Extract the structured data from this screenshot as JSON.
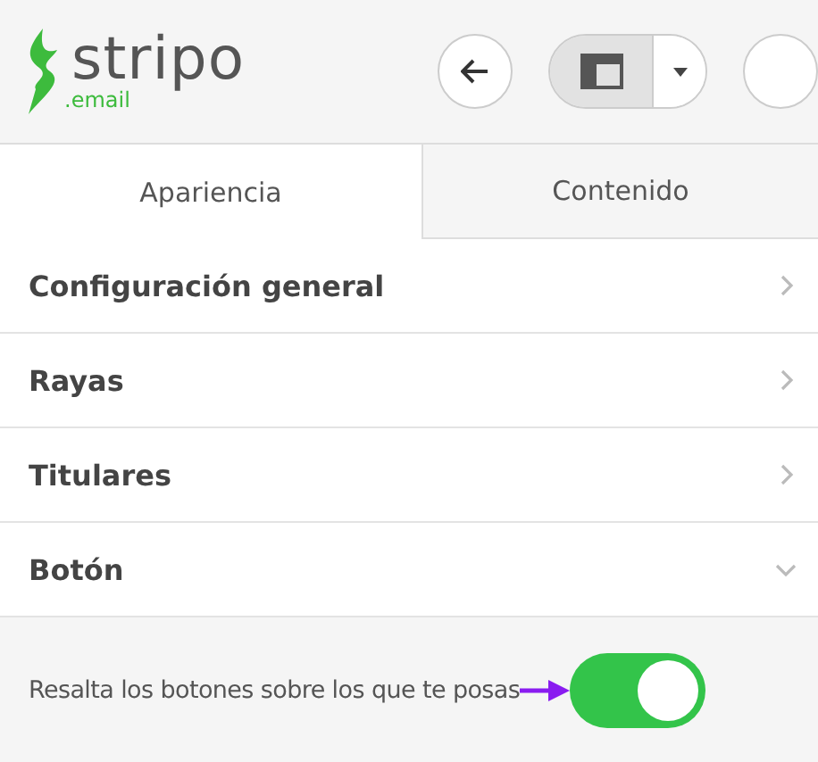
{
  "logo": {
    "name": "stripo",
    "suffix": ".email"
  },
  "toolbar": {
    "buttons": [
      {
        "kind": "back"
      },
      {
        "kind": "layout",
        "selected": true
      }
    ]
  },
  "tabs": [
    {
      "label": "Apariencia",
      "selected": true
    },
    {
      "label": "Contenido",
      "selected": false
    }
  ],
  "sections": [
    {
      "title": "Configuración general",
      "expanded": false
    },
    {
      "title": "Rayas",
      "expanded": false
    },
    {
      "title": "Titulares",
      "expanded": false
    },
    {
      "title": "Botón",
      "expanded": true
    }
  ],
  "setting": {
    "label": "Resalta los botones sobre los que te posas",
    "on": true
  }
}
